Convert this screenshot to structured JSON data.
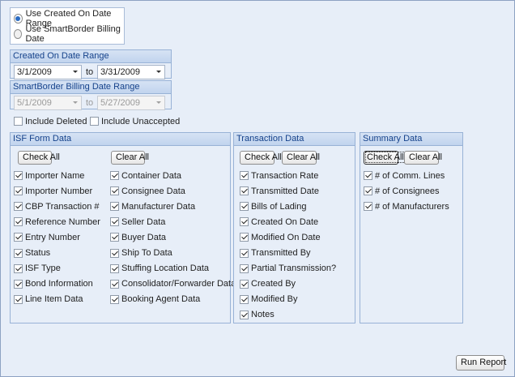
{
  "date_mode": {
    "options": [
      {
        "label": "Use Created On Date Range",
        "selected": true
      },
      {
        "label": "Use SmartBorder Billing Date",
        "selected": false
      }
    ]
  },
  "created_range": {
    "title": "Created On Date Range",
    "from": "3/1/2009",
    "to_label": "to",
    "to": "3/31/2009"
  },
  "billing_range": {
    "title": "SmartBorder Billing Date Range",
    "from": "5/1/2009",
    "to_label": "to",
    "to": "5/27/2009",
    "disabled": true
  },
  "filters": {
    "include_deleted": {
      "label": "Include Deleted",
      "checked": false
    },
    "include_unaccepted": {
      "label": "Include Unaccepted",
      "checked": false
    }
  },
  "isf": {
    "title": "ISF Form Data",
    "check_all": "Check All",
    "clear_all": "Clear All",
    "col1": [
      {
        "label": "Importer Name",
        "checked": true
      },
      {
        "label": "Importer Number",
        "checked": true
      },
      {
        "label": "CBP Transaction #",
        "checked": true
      },
      {
        "label": "Reference Number",
        "checked": true
      },
      {
        "label": "Entry Number",
        "checked": true
      },
      {
        "label": "Status",
        "checked": true
      },
      {
        "label": "ISF Type",
        "checked": true
      },
      {
        "label": "Bond Information",
        "checked": true
      },
      {
        "label": "Line Item Data",
        "checked": true
      }
    ],
    "col2": [
      {
        "label": "Container Data",
        "checked": true
      },
      {
        "label": "Consignee Data",
        "checked": true
      },
      {
        "label": "Manufacturer Data",
        "checked": true
      },
      {
        "label": "Seller Data",
        "checked": true
      },
      {
        "label": "Buyer Data",
        "checked": true
      },
      {
        "label": "Ship To Data",
        "checked": true
      },
      {
        "label": "Stuffing Location Data",
        "checked": true
      },
      {
        "label": "Consolidator/Forwarder Data",
        "checked": true
      },
      {
        "label": "Booking Agent Data",
        "checked": true
      }
    ]
  },
  "transaction": {
    "title": "Transaction Data",
    "check_all": "Check All",
    "clear_all": "Clear All",
    "items": [
      {
        "label": "Transaction Rate",
        "checked": true
      },
      {
        "label": "Transmitted Date",
        "checked": true
      },
      {
        "label": "Bills of Lading",
        "checked": true
      },
      {
        "label": "Created On Date",
        "checked": true
      },
      {
        "label": "Modified On Date",
        "checked": true
      },
      {
        "label": "Transmitted By",
        "checked": true
      },
      {
        "label": "Partial Transmission?",
        "checked": true
      },
      {
        "label": "Created By",
        "checked": true
      },
      {
        "label": "Modified By",
        "checked": true
      },
      {
        "label": "Notes",
        "checked": true
      }
    ]
  },
  "summary": {
    "title": "Summary Data",
    "check_all": "Check All",
    "clear_all": "Clear All",
    "items": [
      {
        "label": "# of Comm. Lines",
        "checked": true
      },
      {
        "label": "# of Consignees",
        "checked": true
      },
      {
        "label": "# of Manufacturers",
        "checked": true
      }
    ]
  },
  "run_report": "Run Report"
}
